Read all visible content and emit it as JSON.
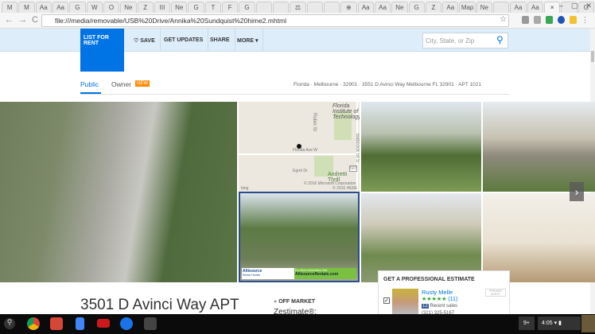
{
  "browser": {
    "tabs": [
      "M",
      "M",
      "Aa",
      "Aa",
      "G",
      "W",
      "O",
      "Ne",
      "Z",
      "III",
      "Ne",
      "G",
      "T",
      "F",
      "G",
      "",
      "",
      "⚖",
      "",
      "",
      "⊕",
      "Aa",
      "Aa",
      "Ne",
      "G",
      "Z",
      "Aa",
      "Map",
      "Ne",
      "",
      "Aa",
      "Aa",
      "×",
      "",
      "G"
    ],
    "window_controls": [
      "–",
      "▢",
      "✕"
    ],
    "url": "file:///media/removable/USB%20Drive/Annika%20Sundquist%20hime2.mhtml",
    "back": "←",
    "forward": "→",
    "reload": "C"
  },
  "nav": {
    "list_for_rent": "LIST FOR RENT",
    "save": "♡ SAVE",
    "get_updates": "GET UPDATES",
    "share": "SHARE",
    "more": "MORE ▾",
    "search_placeholder": "City, State, or Zip",
    "brand_color": "#0074e4"
  },
  "tabs": {
    "public": "Public",
    "owner": "Owner",
    "new_badge": "NEW"
  },
  "breadcrumb": [
    "Florida",
    "Melbourne",
    "32901",
    "3551 D Avinci Way Melbourne FL 32901",
    "APT 1021"
  ],
  "map": {
    "labels": {
      "institute": "Florida Institute of Technology",
      "road1": "Robin St",
      "ave": "Florida Ave W",
      "egret": "Egret Dr",
      "babcock": "Babcock St S",
      "route": "507",
      "andretti": "Andretti Thrill",
      "copyright1": "© 2016 Microsoft Corporation",
      "copyright2": "© 2016 HERE",
      "bing": "bing"
    }
  },
  "ad": {
    "brand": "Altisource",
    "sub": "Rental Homes",
    "info": "For More Information Visit",
    "site": "AltisourceRentals.com"
  },
  "listing": {
    "title": "3501 D Avinci Way APT",
    "status": "OFF MARKET",
    "zestimate": "Zestimate®:"
  },
  "estimate": {
    "heading": "GET A PROFESSIONAL ESTIMATE",
    "agent": "Rusty Melle",
    "stars": "★★★★★",
    "reviews": "(11)",
    "sales_count": "12",
    "sales_label": "Recent sales",
    "phone": "(321) 325-5167",
    "badge": "PREMIER AGENT"
  },
  "taskbar": {
    "notifications": "9+",
    "time": "4:05"
  }
}
